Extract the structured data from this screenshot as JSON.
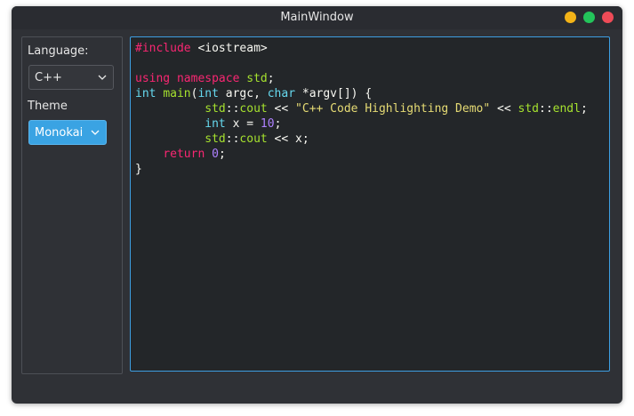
{
  "window": {
    "title": "MainWindow"
  },
  "sidebar": {
    "language_label": "Language:",
    "language_value": "C++",
    "theme_label": "Theme",
    "theme_value": "Monokai"
  },
  "colors": {
    "accent": "#3aa3e3",
    "keyword": "#f92672",
    "function": "#a6e22e",
    "type": "#66d9ef",
    "string": "#e6db74",
    "number": "#ae81ff",
    "text": "#f8f8f2"
  },
  "editor": {
    "lines": [
      [
        {
          "t": "#include",
          "c": "pink"
        },
        {
          "t": " <iostream>",
          "c": "white"
        }
      ],
      [],
      [
        {
          "t": "using",
          "c": "pink"
        },
        {
          "t": " ",
          "c": "white"
        },
        {
          "t": "namespace",
          "c": "pink"
        },
        {
          "t": " ",
          "c": "white"
        },
        {
          "t": "std",
          "c": "green"
        },
        {
          "t": ";",
          "c": "white"
        }
      ],
      [
        {
          "t": "int",
          "c": "cyan"
        },
        {
          "t": " ",
          "c": "white"
        },
        {
          "t": "main",
          "c": "green"
        },
        {
          "t": "(",
          "c": "white"
        },
        {
          "t": "int",
          "c": "cyan"
        },
        {
          "t": " argc, ",
          "c": "white"
        },
        {
          "t": "char",
          "c": "cyan"
        },
        {
          "t": " *argv[]) {",
          "c": "white"
        }
      ],
      [
        {
          "t": "          ",
          "c": "white"
        },
        {
          "t": "std",
          "c": "green"
        },
        {
          "t": "::",
          "c": "white"
        },
        {
          "t": "cout",
          "c": "green"
        },
        {
          "t": " << ",
          "c": "white"
        },
        {
          "t": "\"C++ Code Highlighting Demo\"",
          "c": "yellow"
        },
        {
          "t": " << ",
          "c": "white"
        },
        {
          "t": "std",
          "c": "green"
        },
        {
          "t": "::",
          "c": "white"
        },
        {
          "t": "endl",
          "c": "green"
        },
        {
          "t": ";",
          "c": "white"
        }
      ],
      [
        {
          "t": "          ",
          "c": "white"
        },
        {
          "t": "int",
          "c": "cyan"
        },
        {
          "t": " x = ",
          "c": "white"
        },
        {
          "t": "10",
          "c": "purple"
        },
        {
          "t": ";",
          "c": "white"
        }
      ],
      [
        {
          "t": "          ",
          "c": "white"
        },
        {
          "t": "std",
          "c": "green"
        },
        {
          "t": "::",
          "c": "white"
        },
        {
          "t": "cout",
          "c": "green"
        },
        {
          "t": " << x;",
          "c": "white"
        }
      ],
      [
        {
          "t": "    ",
          "c": "white"
        },
        {
          "t": "return",
          "c": "pink"
        },
        {
          "t": " ",
          "c": "white"
        },
        {
          "t": "0",
          "c": "purple"
        },
        {
          "t": ";",
          "c": "white"
        }
      ],
      [
        {
          "t": "}",
          "c": "white"
        }
      ]
    ]
  }
}
